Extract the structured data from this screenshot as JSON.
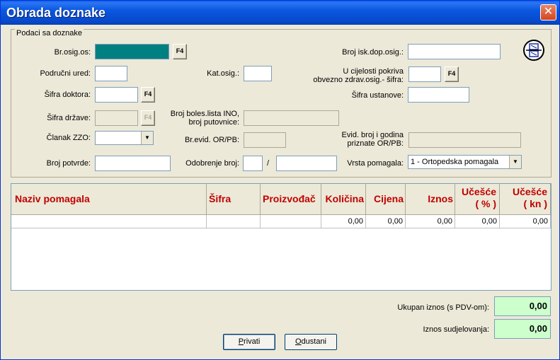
{
  "window": {
    "title": "Obrada doznake",
    "close_glyph": "✕"
  },
  "group": {
    "legend": "Podaci sa doznake"
  },
  "fields": {
    "br_osig_os": {
      "label": "Br.osig.os:",
      "value": ""
    },
    "podrucni_ured": {
      "label": "Područni ured:",
      "value": ""
    },
    "kat_osig": {
      "label": "Kat.osig.:",
      "value": ""
    },
    "sifra_doktora": {
      "label": "Šifra doktora:",
      "value": ""
    },
    "sifra_drzave": {
      "label": "Šifra države:",
      "value": ""
    },
    "broj_boles_lista": {
      "label1": "Broj boles.lista INO,",
      "label2": "broj putovnice:",
      "value": ""
    },
    "clanak_zzo": {
      "label": "Članak ZZO:",
      "value": ""
    },
    "br_evid": {
      "label": "Br.evid. OR/PB:",
      "value": ""
    },
    "broj_potvrde": {
      "label": "Broj potvrde:",
      "value": ""
    },
    "odobrenje_broj": {
      "label": "Odobrenje broj:",
      "separator": "/",
      "value1": "",
      "value2": ""
    },
    "broj_isk_dop": {
      "label": "Broj isk.dop.osig.:",
      "value": ""
    },
    "u_cijelosti": {
      "label1": "U cijelosti pokriva",
      "label2": "obvezno zdrav.osig.- šifra:",
      "value": ""
    },
    "sifra_ustanove": {
      "label": "Šifra ustanove:",
      "value": ""
    },
    "evid_broj": {
      "label1": "Evid. broj i godina",
      "label2": "priznate OR/PB:",
      "value": ""
    },
    "vrsta_pomagala": {
      "label": "Vrsta pomagala:",
      "value": "1 - Ortopedska  pomagala"
    }
  },
  "lookup_button_label": "F4",
  "table": {
    "headers": {
      "naziv": "Naziv pomagala",
      "sifra": "Šifra",
      "proizvodac": "Proizvođač",
      "kolicina": "Količina",
      "cijena": "Cijena",
      "iznos": "Iznos",
      "ucesce_pct_1": "Učešće",
      "ucesce_pct_2": "( % )",
      "ucesce_kn_1": "Učešće",
      "ucesce_kn_2": "( kn )"
    },
    "row": {
      "naziv": "",
      "sifra": "",
      "proizvodac": "",
      "kolicina": "0,00",
      "cijena": "0,00",
      "iznos": "0,00",
      "ucesce_pct": "0,00",
      "ucesce_kn": "0,00"
    }
  },
  "totals": {
    "ukupan_label": "Ukupan iznos (s PDV-om):",
    "ukupan_value": "0,00",
    "sudjelovanja_label": "Iznos sudjelovanja:",
    "sudjelovanja_value": "0,00"
  },
  "buttons": {
    "privati": {
      "first": "P",
      "rest": "rivati"
    },
    "odustani": {
      "first": "O",
      "rest": "dustani"
    }
  }
}
